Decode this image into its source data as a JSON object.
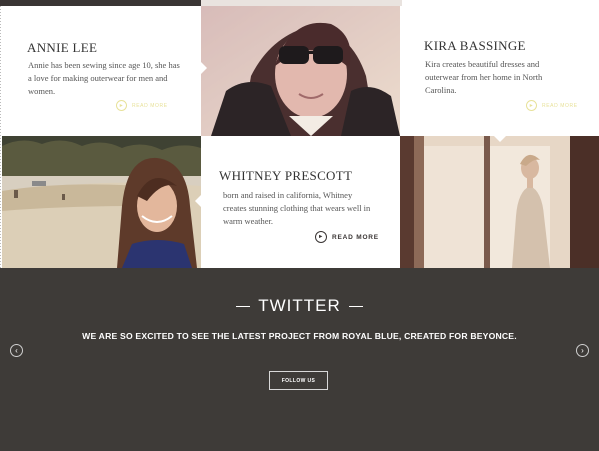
{
  "profiles": [
    {
      "name": "ANNIE LEE",
      "bio": "Annie has been sewing since age 10, she has a love for making outerwear for men and women.",
      "read_more": "READ MORE"
    },
    {
      "name": "KIRA BASSINGE",
      "bio": "Kira creates beautiful dresses and outerwear from her home in North Carolina.",
      "read_more": "READ MORE"
    },
    {
      "name": "WHITNEY PRESCOTT",
      "bio": "born and raised in california, Whitney creates stunning clothing that wears well in warm weather.",
      "read_more": "READ MORE"
    }
  ],
  "twitter": {
    "title": "TWITTER",
    "tweet": "WE ARE SO EXCITED TO SEE THE LATEST PROJECT FROM ROYAL BLUE, CREATED FOR BEYONCE.",
    "follow_label": "FOLLOW US",
    "prev_icon": "‹",
    "next_icon": "›"
  },
  "colors": {
    "dark_bg": "#3e3b38",
    "accent_pale": "#e8e29a",
    "text_dark": "#333333"
  }
}
